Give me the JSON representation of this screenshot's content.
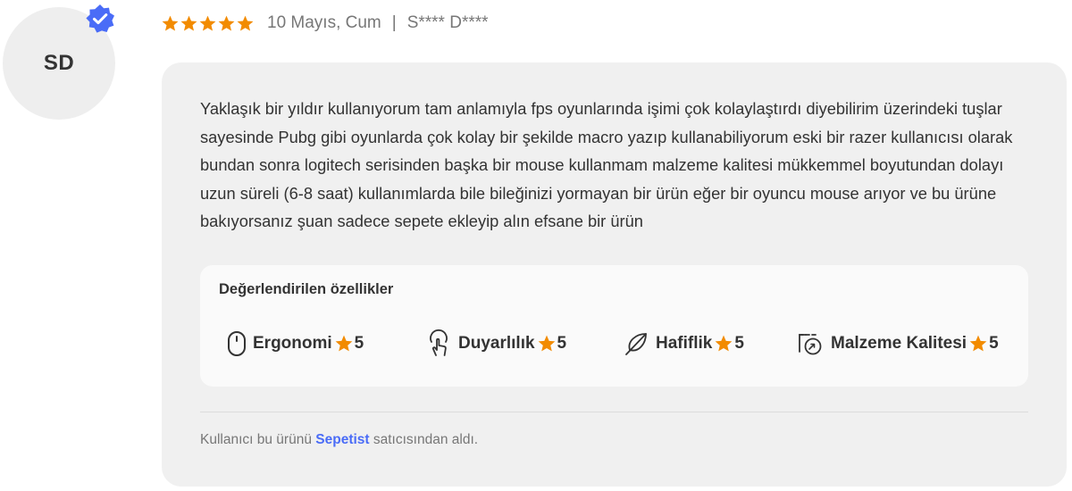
{
  "reviewer": {
    "initials": "SD",
    "verified": true,
    "masked_name": "S**** D****"
  },
  "header": {
    "rating": 5,
    "rating_max": 5,
    "date": "10 Mayıs, Cum",
    "separator": "|"
  },
  "review": {
    "text": "Yaklaşık bir yıldır kullanıyorum tam anlamıyla fps oyunlarında işimi çok kolaylaştırdı diyebilirim üzerindeki tuşlar sayesinde Pubg gibi oyunlarda  çok kolay bir şekilde macro yazıp kullanabiliyorum eski bir razer kullanıcısı olarak bundan sonra logitech serisinden başka bir mouse kullanmam malzeme kalitesi mükkemmel boyutundan dolayı uzun süreli (6-8 saat) kullanımlarda bile bileğinizi yormayan bir ürün eğer bir oyuncu mouse arıyor ve bu ürüne bakıyorsanız şuan sadece sepete ekleyip alın efsane bir ürün"
  },
  "features": {
    "title": "Değerlendirilen özellikler",
    "items": [
      {
        "icon": "mouse-icon",
        "name": "Ergonomi",
        "score": "5"
      },
      {
        "icon": "touch-hand-icon",
        "name": "Duyarlılık",
        "score": "5"
      },
      {
        "icon": "feather-icon",
        "name": "Hafiflik",
        "score": "5"
      },
      {
        "icon": "material-quality-icon",
        "name": "Malzeme Kalitesi",
        "score": "5"
      }
    ]
  },
  "seller": {
    "prefix": "Kullanıcı bu ürünü ",
    "name": "Sepetist",
    "suffix": " satıcısından aldı."
  },
  "colors": {
    "star": "#f28b00",
    "badge": "#4a6cf7",
    "link": "#4a6cf7",
    "card_bg": "#f0f0f0",
    "avatar_bg": "#eeeeee"
  }
}
